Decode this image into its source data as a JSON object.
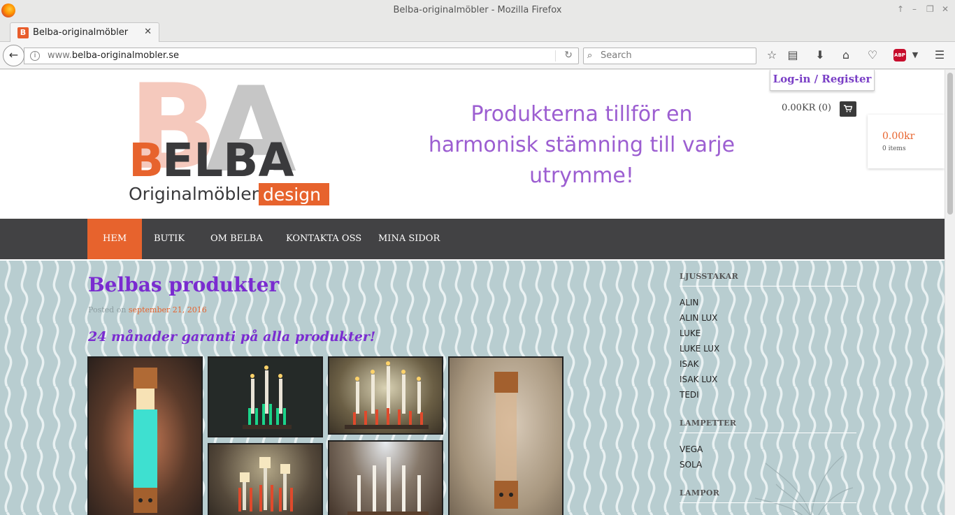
{
  "browser": {
    "window_title": "Belba-originalmöbler - Mozilla Firefox",
    "tab_title": "Belba-originalmöbler",
    "url_prefix": "www.",
    "url_domain": "belba-originalmobler.se",
    "search_placeholder": "Search"
  },
  "header": {
    "tagline": "Produkterna tillför en harmonisk stämning till varje utrymme!",
    "login_label": "Log-in / Register",
    "cart_summary": "0.00KR (0)",
    "mini_cart_amount": "0.00kr",
    "mini_cart_items": "0 items",
    "logo": {
      "big_letters": "BA",
      "name": "BELBA",
      "subtitle": "Originalmöbler",
      "design_word": "design",
      "colors": {
        "orange": "#e7632d",
        "dark": "#3a3a3c",
        "grey": "#c6c6c6",
        "pink": "#f5c9bd"
      }
    }
  },
  "nav": {
    "items": [
      {
        "label": "HEM",
        "active": true
      },
      {
        "label": "BUTIK",
        "active": false
      },
      {
        "label": "OM BELBA",
        "active": false
      },
      {
        "label": "KONTAKTA OSS",
        "active": false
      },
      {
        "label": "MINA SIDOR",
        "active": false
      }
    ]
  },
  "post": {
    "title": "Belbas produkter",
    "posted_on_label": "Posted on",
    "posted_date": "september 21, 2016",
    "guarantee": "24 månader garanti på alla produkter!"
  },
  "sidebar": {
    "sections": [
      {
        "title": "LJUSSTAKAR",
        "links": [
          "ALIN",
          "ALIN LUX",
          "LUKE",
          "LUKE LUX",
          "ISAK",
          "ISAK LUX",
          "TEDI"
        ]
      },
      {
        "title": "LAMPETTER",
        "links": [
          "VEGA",
          "SOLA"
        ]
      },
      {
        "title": "LAMPOR",
        "links": []
      }
    ]
  },
  "colors": {
    "accent_orange": "#e7632d",
    "title_purple": "#7a2bd0",
    "tagline_purple": "#9c5ed1",
    "nav_bg": "#424244",
    "content_bg": "#b8cdd0"
  }
}
